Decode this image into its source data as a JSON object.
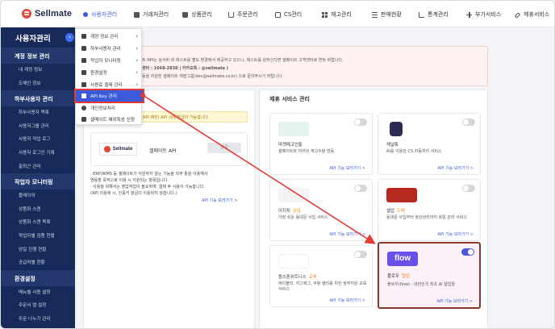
{
  "brand": {
    "name": "Sellmate"
  },
  "nav": [
    {
      "label": "사용자관리",
      "icon": "user-icon"
    },
    {
      "label": "거래처관리",
      "icon": "box-icon"
    },
    {
      "label": "상품관리",
      "icon": "bag-icon"
    },
    {
      "label": "주문관리",
      "icon": "cart-icon"
    },
    {
      "label": "CS관리",
      "icon": "doc-icon"
    },
    {
      "label": "재고관리",
      "icon": "grid-icon"
    },
    {
      "label": "판매현황",
      "icon": "list-icon"
    },
    {
      "label": "통계관리",
      "icon": "chart-icon"
    },
    {
      "label": "부가서비스",
      "icon": "plus-icon"
    },
    {
      "label": "제휴서비스",
      "icon": "link-icon"
    }
  ],
  "sidebar": {
    "title": "사용자관리",
    "sections": [
      {
        "title": "계정 정보 관리",
        "items": [
          "내 계정 정보",
          "도메인 정보"
        ]
      },
      {
        "title": "하부사용자 관리",
        "items": [
          "하부사용자 목록",
          "사용자그룹 관리",
          "사용자 작업 로그",
          "사용자 로그인 기록",
          "출퇴근 관리"
        ]
      },
      {
        "title": "작업자 모니터링",
        "items": [
          "플레이어",
          "상품화 스캔",
          "상품화 스캔 목록",
          "작업자별 검품 현황",
          "당일 진행 현황",
          "공급처별 현황"
        ]
      },
      {
        "title": "환경설정",
        "items": [
          "메뉴별 사용 설정",
          "주문서 열 설정",
          "주문 나누기 관리"
        ]
      }
    ]
  },
  "dropdown": {
    "items": [
      {
        "label": "계정 정보 관리",
        "has_submenu": true
      },
      {
        "label": "하부사용자 관리",
        "has_submenu": true
      },
      {
        "label": "작업자 모니터링",
        "has_submenu": true
      },
      {
        "label": "환경설정",
        "has_submenu": true
      },
      {
        "label": "사용료 결제 관리",
        "has_submenu": true
      },
      {
        "label": "API Key 관리",
        "has_submenu": false,
        "selected": true
      },
      {
        "label": "개인정보처리",
        "has_submenu": false
      },
      {
        "label": "셀메이트 해외특송 신청",
        "has_submenu": false
      }
    ]
  },
  "notice": {
    "lines": [
      "트 API는 실서버 외 테스트를 별도 환경에서 제공하고 있으니, 테스트를 원하신다면 셀메이트 고객센터로 연락 바랍니다.",
      "센터 : 1668-2830 | 카카오톡 : @sellmate )",
      "등을 지원한 셀메이트 개발그룹(dev@sellmate.co.kr) 으로 문의주시기 바랍니다."
    ]
  },
  "api_panel": {
    "warning": "(API 제한) API 시에 발급이 가능합니다.",
    "logo_text": "Sellmate",
    "name": "셀메이트 API",
    "button": "발급",
    "notes": [
      "· ERP/WMS 등 셀메이트가 지원하지 않는 기능을 외부 툴을 이용해서",
      "  연동할 목적으로 이용 시 지원되는 항목입니다.",
      "· 사용을 위해서는 영업적업이 필요하며, 결제 후 사용이 가능합니다.",
      "  (API 이용에 시, 인증키 발급이 이용되지 않습니다.)"
    ],
    "link": "API 기능 보러가기 >"
  },
  "partner_panel": {
    "title": "제휴 서비스 관리",
    "services": [
      {
        "name": "마켓메고인들",
        "tag": "",
        "desc": "셀메이트와 미러의 재고수량 연동",
        "link": "API 기능 보러가기 >",
        "enabled": false,
        "logo": "market-logo",
        "logo_color": "#e4f4f1"
      },
      {
        "name": "채널톡",
        "tag": "",
        "desc": "AI를 이용한 CS 자동처리 서비스",
        "link": "API 기능 보러가기 >",
        "enabled": false,
        "logo": "channeltalk-logo",
        "logo_color": "#2d2a54"
      },
      {
        "name": "이지치",
        "tag": "상담",
        "desc": "가장 쉬운 동대문 사입 서비스",
        "link": "API 기능 보러가기 >",
        "enabled": false,
        "logo": "easy-logo",
        "logo_color": "#f3f3f3"
      },
      {
        "name": "셀업",
        "tag": "도매",
        "desc": "동대문 사입부터 정산관리까지 토탈 관리 서비스",
        "link": "API 기능 보러가기 >",
        "enabled": false,
        "logo": "sellup-logo",
        "logo_color": "#b7291e"
      },
      {
        "name": "윙스톤위트니스",
        "tag": "교육",
        "desc": "에이블리, 지그재그, 쿠팡 셀러를 위한 정부지원 교육 서비스",
        "link": "API 기능 보러가기 >",
        "enabled": false,
        "logo": "winastone-logo",
        "logo_color": "#ffffff"
      },
      {
        "name": "플로우",
        "tag": "협업",
        "desc": "플로우(flow) - 대한민국 최초 AI 협업툴",
        "link": "API 기능 보러가기 >",
        "enabled": true,
        "logo": "flow-logo",
        "logo_color": "#6a4fe8",
        "logo_text": "flow"
      }
    ]
  },
  "colors": {
    "accent": "#3b5bdb",
    "sidebar_bg": "#172a5a",
    "annotation_red": "#e53935",
    "highlight_border": "#8b3a2a"
  }
}
